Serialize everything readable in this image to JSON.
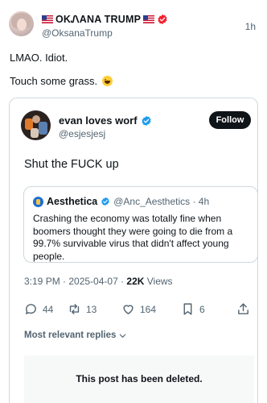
{
  "post": {
    "display_name": "OKᏁANA TRUMP",
    "handle": "@OksanaTrump",
    "time": "1h",
    "lines": [
      "LMAO. Idiot.",
      "Touch some grass."
    ],
    "emoji": "grinning-squinting-face"
  },
  "quoted": {
    "display_name": "evan loves worf",
    "handle": "@esjesjesj",
    "follow_label": "Follow",
    "text": "Shut the FUCK up",
    "nested": {
      "display_name": "Aesthetica",
      "meta": "@Anc_Aesthetics · 4h",
      "text": "Crashing the economy was totally fine when boomers thought they were going to die from a 99.7% survivable virus that didn't affect young people."
    },
    "timestamp": "3:19 PM · 2025-04-07 · ",
    "views_count": "22K",
    "views_label": " Views",
    "actions": {
      "replies": "44",
      "reposts": "13",
      "likes": "164",
      "bookmarks": "6"
    },
    "sort_label": "Most relevant replies",
    "deleted_notice": "This post has been deleted."
  },
  "colors": {
    "text": "#0f1419",
    "secondary": "#536471",
    "verified_blue": "#1d9bf0",
    "verified_red": "#f4212e",
    "border": "#cfd9de",
    "follow_bg": "#0f1419"
  },
  "icons": [
    "us-flag-icon",
    "verified-badge-icon",
    "reply-icon",
    "repost-icon",
    "like-icon",
    "bookmark-icon",
    "share-icon",
    "chevron-down-icon"
  ]
}
